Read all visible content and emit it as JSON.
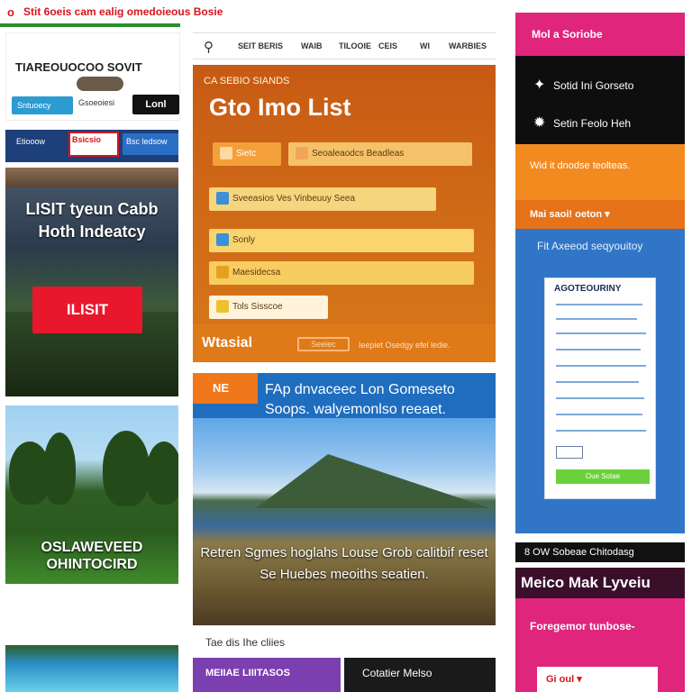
{
  "header": {
    "logo_glyph": "o",
    "title": "Stit 6oeis cam ealig omedoieous Bosie"
  },
  "left": {
    "brand_title": "TIAREOUOCOO SOVIT",
    "brand_pill_blue": "Sntuoecy",
    "brand_mini_text": "Gsoeoiesi",
    "brand_pill_dark": "Lonl",
    "strip_tags": [
      "Etiooow",
      "Bsicsio",
      "Bsc ledsow"
    ],
    "hero_heading": "LISIT tyeun Cabb Hoth Indeatcy",
    "hero_cta": "ILISIT",
    "golf_caption": "OSLAWEVEED OHINTOCIRD"
  },
  "nav": {
    "search_icon": "search-icon",
    "items": [
      "SEIT BERIS",
      "WAIB",
      "TILOOIE",
      "CEIS",
      "WI",
      "WARBIES"
    ]
  },
  "orange_panel": {
    "kicker": "CA SEBIO SIANDS",
    "title": "Gto Imo List",
    "rows": [
      {
        "label": "Sietc",
        "color": "#f3a03a"
      },
      {
        "label": "Seoaleaodcs Beadleas",
        "color": "#f5c26a"
      },
      {
        "label": "Sveeasios Ves Vinbeuuy Seea",
        "color": "#f6d57f"
      },
      {
        "label": "Sonly",
        "color": "#f9d46f"
      },
      {
        "label": "Maesidecsa",
        "color": "#f7cd5f"
      },
      {
        "label": "Tols Sisscoe",
        "color": "#fff3db"
      }
    ],
    "footer_label": "Wtasial",
    "footer_button": "Seeiec",
    "footer_text": "Ieepiet Osedgy efel ledie."
  },
  "feature": {
    "tag": "NE",
    "headline": "FAp dnvaceec Lon Gomeseto Soops. walyemonlso reeaet.",
    "caption": "Retren Sgmes hoglahs Louse Grob calitbif reset Se Huebes meoiths seatien."
  },
  "mid_footer": {
    "text": "Tae dis Ihe cliies",
    "purple_button": "MEIIAE LIIITASOS",
    "dark_button": "Cotatier Melso"
  },
  "right": {
    "top_label": "Mol a Soriobe",
    "black_rows": [
      {
        "icon": "bird-icon",
        "glyph": "✦",
        "label": "Sotid Ini Gorseto"
      },
      {
        "icon": "gear-icon",
        "glyph": "✹",
        "label": "Setin Feolo Heh"
      }
    ],
    "orange_text": "Wid it dnodse teolteas.",
    "orange_dropdown": "Mai saoi! oeton",
    "blue_title": "Fit Axeeod seqyouitoy",
    "doc_heading": "AGOTEOURINY",
    "doc_button": "Oue Sotae",
    "dark_title": "8 OW Sobeae Chitodasg",
    "pink_heading": "Meico Mak Lyveiu",
    "pink_text": "Foregemor tunbose-",
    "pink_select": "Gi oul"
  }
}
